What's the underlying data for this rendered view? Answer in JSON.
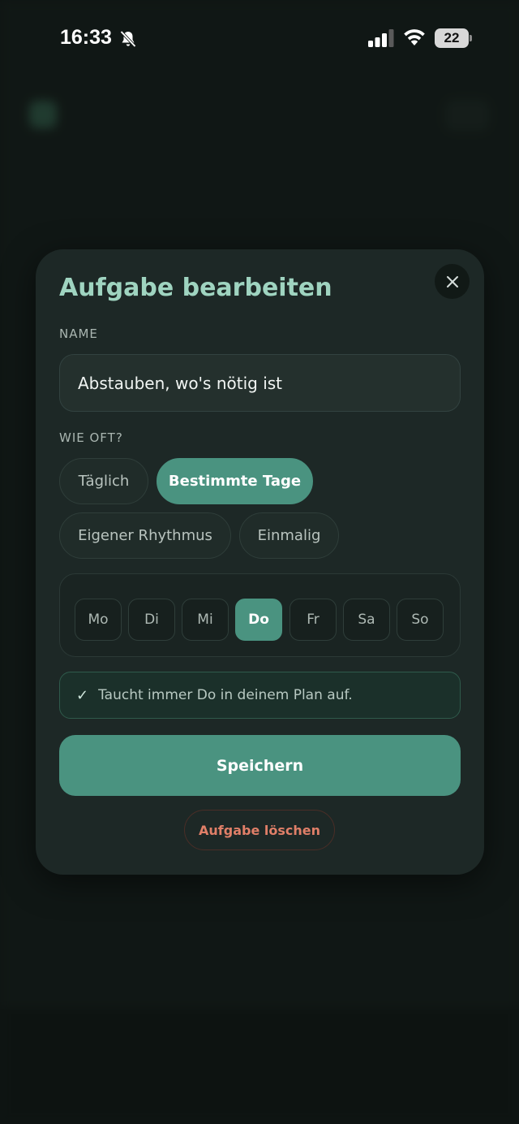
{
  "status_bar": {
    "time": "16:33",
    "battery": "22"
  },
  "modal": {
    "title": "Aufgabe bearbeiten",
    "name_label": "NAME",
    "name_value": "Abstauben, wo's nötig ist",
    "frequency_label": "WIE OFT?",
    "frequency_options": [
      {
        "label": "Täglich",
        "selected": false
      },
      {
        "label": "Bestimmte Tage",
        "selected": true
      },
      {
        "label": "Eigener Rhythmus",
        "selected": false
      },
      {
        "label": "Einmalig",
        "selected": false
      }
    ],
    "days": [
      {
        "label": "Mo",
        "selected": false
      },
      {
        "label": "Di",
        "selected": false
      },
      {
        "label": "Mi",
        "selected": false
      },
      {
        "label": "Do",
        "selected": true
      },
      {
        "label": "Fr",
        "selected": false
      },
      {
        "label": "Sa",
        "selected": false
      },
      {
        "label": "So",
        "selected": false
      }
    ],
    "info_text": "Taucht immer Do in deinem Plan auf.",
    "save_label": "Speichern",
    "delete_label": "Aufgabe löschen"
  },
  "colors": {
    "accent": "#4a9380",
    "title": "#9fd4c0",
    "danger": "#e07f68",
    "modal_bg": "#1d2826"
  },
  "icons": {
    "close": "close-icon",
    "check": "check-icon",
    "bell_muted": "bell-slash-icon",
    "signal": "cellular-signal-icon",
    "wifi": "wifi-icon",
    "battery": "battery-icon"
  }
}
